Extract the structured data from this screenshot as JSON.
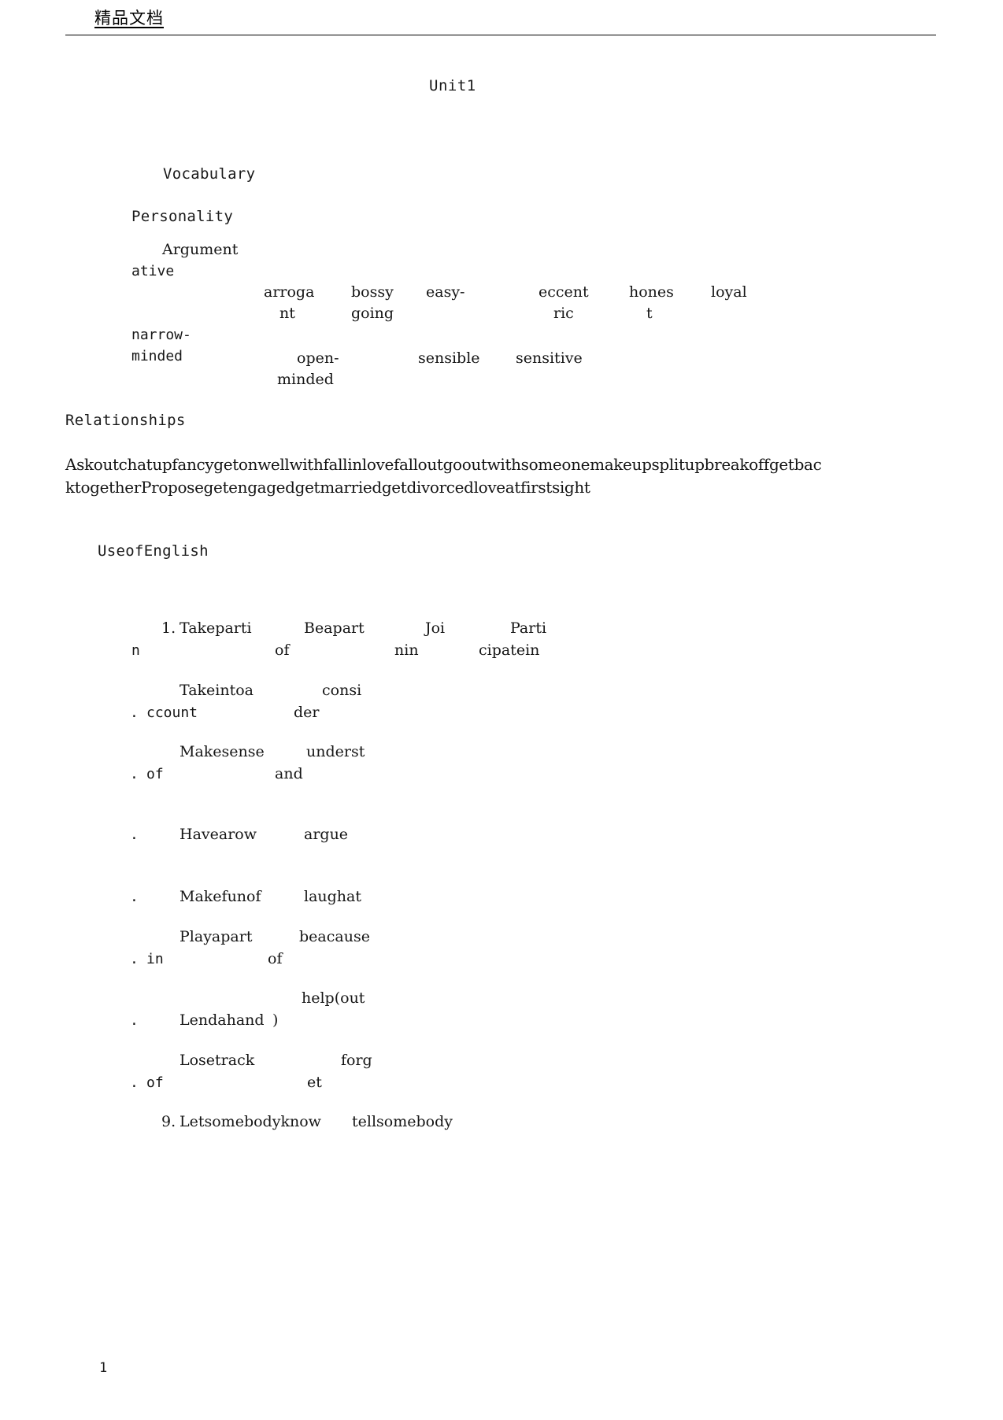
{
  "document": {
    "header_cn": "精品文档",
    "title": "Unit1",
    "page_number": "1"
  },
  "sections": {
    "vocabulary_heading": "Vocabulary",
    "personality_heading": "Personality",
    "relationships_heading": "Relationships",
    "use_of_english_heading": "UseofEnglish"
  },
  "personality_table": {
    "row1": [
      {
        "line1": "Argument",
        "line2": "ative"
      },
      {
        "line1": "arroga",
        "line2": "nt"
      },
      {
        "line1": "bossy",
        "line2": "going"
      },
      {
        "line1": "easy-",
        "line2": ""
      },
      {
        "line1": "eccent",
        "line2": "ric"
      },
      {
        "line1": "hones",
        "line2": "t"
      },
      {
        "line1": "loyal",
        "line2": ""
      }
    ],
    "row2": [
      {
        "line1": "narrow-",
        "line2": "minded"
      },
      {
        "line1": "open-",
        "line2": "minded"
      },
      {
        "line1": "sensible",
        "line2": ""
      },
      {
        "line1": "sensitive",
        "line2": ""
      }
    ]
  },
  "relationships_text": {
    "line1": "Askoutchatupfancygetonwellwithfallinlovefalloutgooutwithsomeonemakeupsplitupbreakoffgetbac",
    "line2": "ktogetherProposegetengagedgetmarriedgetdivorcedloveatfirstsight"
  },
  "use_of_english_items": [
    {
      "number": "1.",
      "left_line1": "Takeparti",
      "left_line2": "n",
      "mid_line1": "Beapart",
      "mid_line2": "of",
      "right_line1": "Joi",
      "right_line2": "nin",
      "far_line1": "Parti",
      "far_line2": "cipatein"
    },
    {
      "number": ".",
      "left_line1": "Takeintoa",
      "left_line2": "ccount",
      "mid_line1": "consi",
      "mid_line2": "der",
      "right_line1": "",
      "right_line2": "",
      "far_line1": "",
      "far_line2": ""
    },
    {
      "number": ".",
      "left_line1": "Makesense",
      "left_line2": "of",
      "mid_line1": "underst",
      "mid_line2": "and",
      "right_line1": "",
      "right_line2": "",
      "far_line1": "",
      "far_line2": ""
    },
    {
      "number": ".",
      "left_line1": "Havearow",
      "left_line2": "",
      "mid_line1": "argue",
      "mid_line2": "",
      "right_line1": "",
      "right_line2": "",
      "far_line1": "",
      "far_line2": ""
    },
    {
      "number": ".",
      "left_line1": "Makefunof",
      "left_line2": "",
      "mid_line1": "laughat",
      "mid_line2": "",
      "right_line1": "",
      "right_line2": "",
      "far_line1": "",
      "far_line2": ""
    },
    {
      "number": ".",
      "left_line1": "Playapart",
      "left_line2": "in",
      "mid_line1": "beacause",
      "mid_line2": "of",
      "right_line1": "",
      "right_line2": "",
      "far_line1": "",
      "far_line2": ""
    },
    {
      "number": ".",
      "left_line1": "Lendahand",
      "left_line2": "",
      "mid_line1": "help(out",
      "mid_line2": ")",
      "right_line1": "",
      "right_line2": "",
      "far_line1": "",
      "far_line2": ""
    },
    {
      "number": ".",
      "left_line1": "Losetrack",
      "left_line2": "of",
      "mid_line1": "forg",
      "mid_line2": "et",
      "right_line1": "",
      "right_line2": "",
      "far_line1": "",
      "far_line2": ""
    },
    {
      "number": "9.",
      "left_line1": "Letsomebodyknow",
      "left_line2": "",
      "mid_line1": "tellsomebody",
      "mid_line2": "",
      "right_line1": "",
      "right_line2": "",
      "far_line1": "",
      "far_line2": ""
    }
  ]
}
